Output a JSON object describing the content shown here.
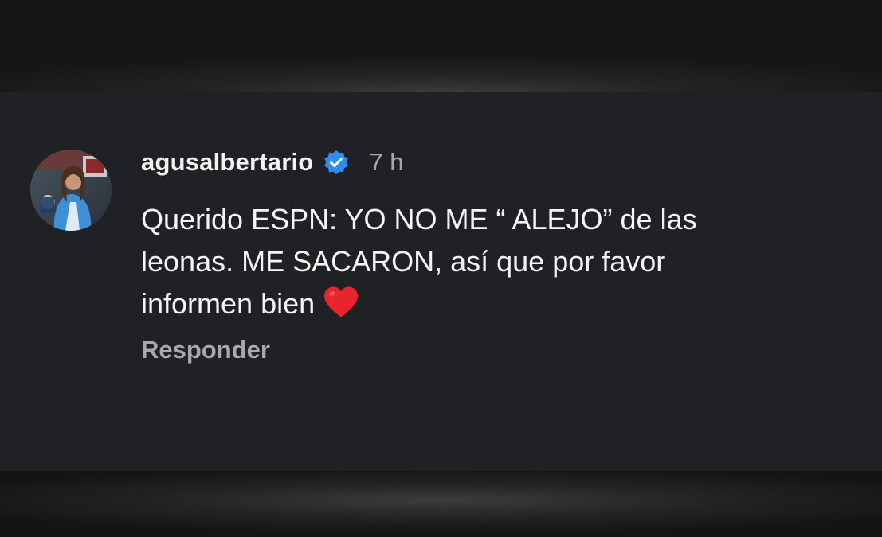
{
  "comment": {
    "username": "agusalbertario",
    "verified": true,
    "timestamp": "7 h",
    "text_line1": "Querido ESPN: YO NO ME “ ALEJO” de las",
    "text_line2": "leonas. ME SACARON, así que por favor",
    "text_line3": "informen bien",
    "emoji": "red-heart",
    "reply_label": "Responder"
  },
  "colors": {
    "card_background": "#1f2124",
    "verified_badge": "#2f8cf0",
    "heart": "#e8242f",
    "username_text": "#f2f2f2",
    "secondary_text": "#a8a8a8"
  }
}
